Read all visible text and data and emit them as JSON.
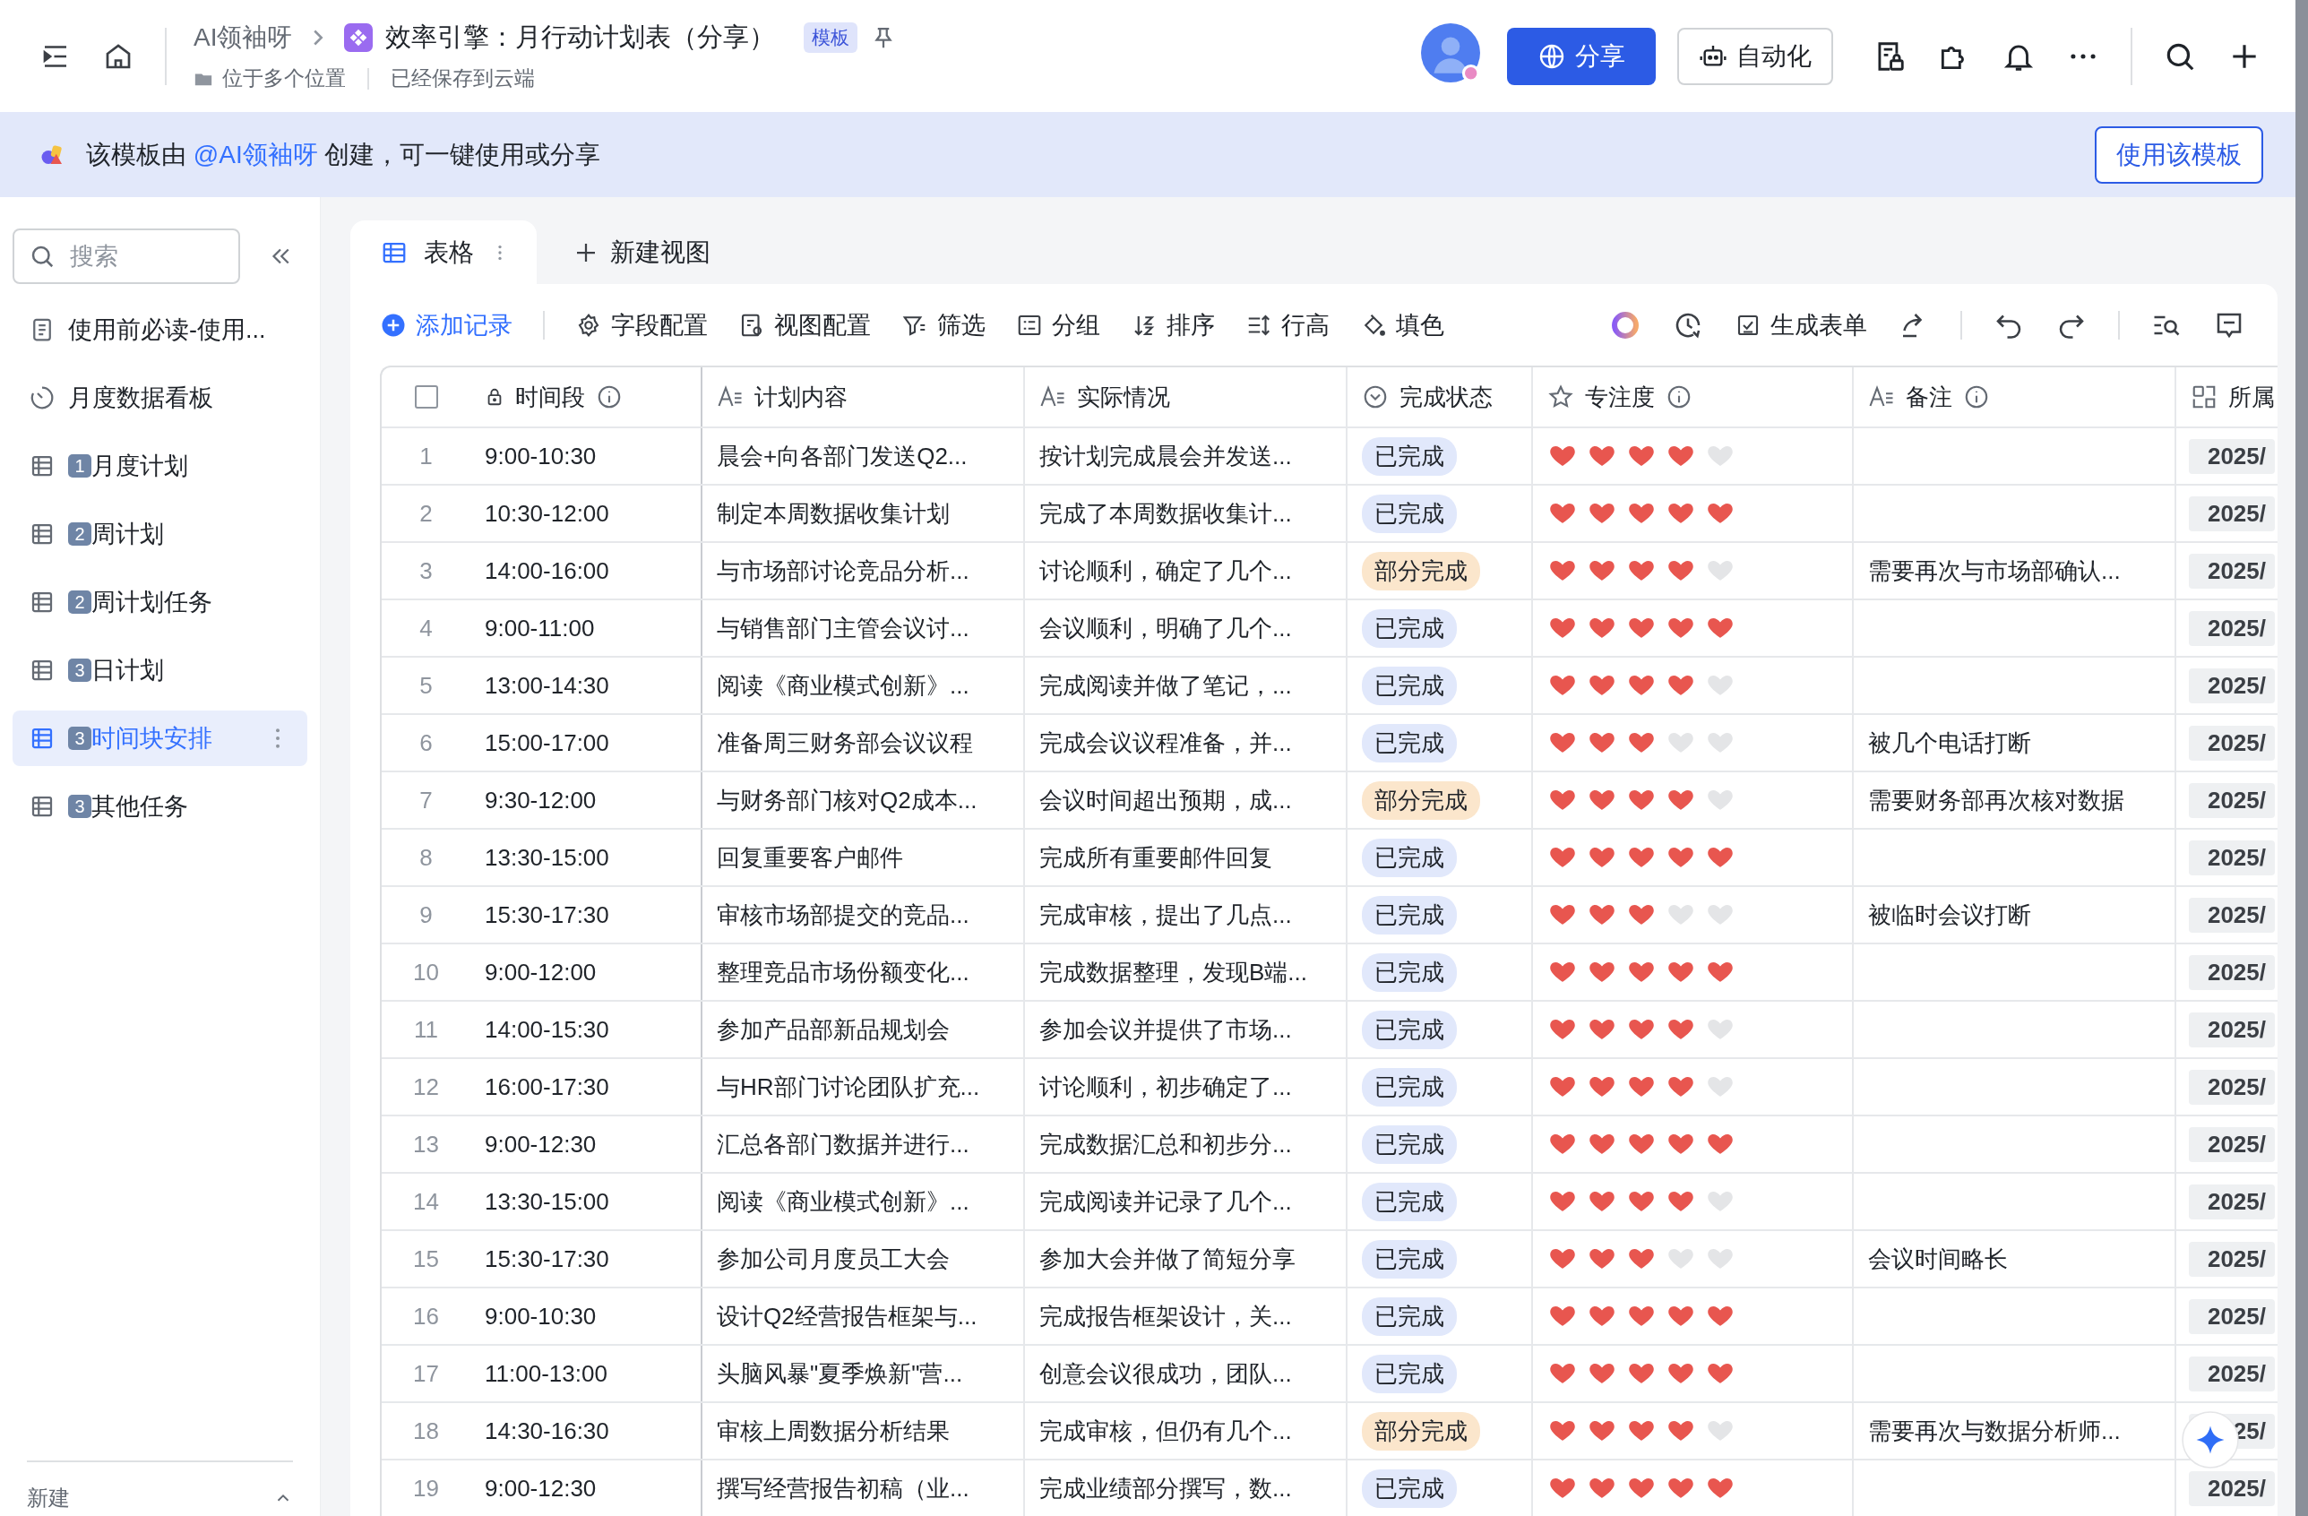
{
  "topbar": {
    "breadcrumb": "AI领袖呀",
    "title": "效率引擎：月行动计划表（分享）",
    "tag": "模板",
    "location": "位于多个位置",
    "save_status": "已经保存到云端",
    "share_button": "分享",
    "automation_button": "自动化"
  },
  "banner": {
    "before": "该模板由 ",
    "link": "@AI领袖呀",
    "after": " 创建，可一键使用或分享",
    "button": "使用该模板"
  },
  "sidebar": {
    "search": {
      "placeholder": "搜索"
    },
    "items": [
      {
        "kind": "doc",
        "label": "使用前必读-使用...",
        "selected": false
      },
      {
        "kind": "dashboard",
        "label": "月度数据看板",
        "selected": false
      },
      {
        "kind": "table",
        "badge": "1",
        "label": "月度计划",
        "selected": false
      },
      {
        "kind": "table",
        "badge": "2",
        "label": "周计划",
        "selected": false
      },
      {
        "kind": "table",
        "badge": "2",
        "label": "周计划任务",
        "selected": false
      },
      {
        "kind": "table",
        "badge": "3",
        "label": "日计划",
        "selected": false
      },
      {
        "kind": "table",
        "badge": "3",
        "label": "时间块安排",
        "selected": true
      },
      {
        "kind": "table",
        "badge": "3",
        "label": "其他任务",
        "selected": false
      }
    ],
    "footer": "新建"
  },
  "views": {
    "tabs": [
      {
        "label": "表格",
        "selected": true
      }
    ],
    "new_view": "新建视图"
  },
  "toolbar": {
    "add": "添加记录",
    "items": [
      "字段配置",
      "视图配置",
      "筛选",
      "分组",
      "排序",
      "行高",
      "填色"
    ],
    "form": "生成表单"
  },
  "table": {
    "select_all_checked": false,
    "columns": [
      {
        "kind": "time",
        "label": "时间段"
      },
      {
        "kind": "text",
        "label": "计划内容"
      },
      {
        "kind": "text",
        "label": "实际情况"
      },
      {
        "kind": "status",
        "label": "完成状态"
      },
      {
        "kind": "rating",
        "label": "专注度"
      },
      {
        "kind": "note",
        "label": "备注"
      },
      {
        "kind": "owner",
        "label": "所属"
      }
    ],
    "rows": [
      {
        "num": "1",
        "time": "9:00-10:30",
        "plan": "晨会+向各部门发送Q2...",
        "actual": "按计划完成晨会并发送...",
        "status": "已完成",
        "kind": "done",
        "stars": 4,
        "note": "",
        "owner": "2025/"
      },
      {
        "num": "2",
        "time": "10:30-12:00",
        "plan": "制定本周数据收集计划",
        "actual": "完成了本周数据收集计...",
        "status": "已完成",
        "kind": "done",
        "stars": 5,
        "note": "",
        "owner": "2025/"
      },
      {
        "num": "3",
        "time": "14:00-16:00",
        "plan": "与市场部讨论竞品分析...",
        "actual": "讨论顺利，确定了几个...",
        "status": "部分完成",
        "kind": "partial",
        "stars": 4,
        "note": "需要再次与市场部确认...",
        "owner": "2025/"
      },
      {
        "num": "4",
        "time": "9:00-11:00",
        "plan": "与销售部门主管会议讨...",
        "actual": "会议顺利，明确了几个...",
        "status": "已完成",
        "kind": "done",
        "stars": 5,
        "note": "",
        "owner": "2025/"
      },
      {
        "num": "5",
        "time": "13:00-14:30",
        "plan": "阅读《商业模式创新》...",
        "actual": "完成阅读并做了笔记，...",
        "status": "已完成",
        "kind": "done",
        "stars": 4,
        "note": "",
        "owner": "2025/"
      },
      {
        "num": "6",
        "time": "15:00-17:00",
        "plan": "准备周三财务部会议议程",
        "actual": "完成会议议程准备，并...",
        "status": "已完成",
        "kind": "done",
        "stars": 3,
        "note": "被几个电话打断",
        "owner": "2025/"
      },
      {
        "num": "7",
        "time": "9:30-12:00",
        "plan": "与财务部门核对Q2成本...",
        "actual": "会议时间超出预期，成...",
        "status": "部分完成",
        "kind": "partial",
        "stars": 4,
        "note": "需要财务部再次核对数据",
        "owner": "2025/"
      },
      {
        "num": "8",
        "time": "13:30-15:00",
        "plan": "回复重要客户邮件",
        "actual": "完成所有重要邮件回复",
        "status": "已完成",
        "kind": "done",
        "stars": 5,
        "note": "",
        "owner": "2025/"
      },
      {
        "num": "9",
        "time": "15:30-17:30",
        "plan": "审核市场部提交的竞品...",
        "actual": "完成审核，提出了几点...",
        "status": "已完成",
        "kind": "done",
        "stars": 3,
        "note": "被临时会议打断",
        "owner": "2025/"
      },
      {
        "num": "10",
        "time": "9:00-12:00",
        "plan": "整理竞品市场份额变化...",
        "actual": "完成数据整理，发现B端...",
        "status": "已完成",
        "kind": "done",
        "stars": 5,
        "note": "",
        "owner": "2025/"
      },
      {
        "num": "11",
        "time": "14:00-15:30",
        "plan": "参加产品部新品规划会",
        "actual": "参加会议并提供了市场...",
        "status": "已完成",
        "kind": "done",
        "stars": 4,
        "note": "",
        "owner": "2025/"
      },
      {
        "num": "12",
        "time": "16:00-17:30",
        "plan": "与HR部门讨论团队扩充...",
        "actual": "讨论顺利，初步确定了...",
        "status": "已完成",
        "kind": "done",
        "stars": 4,
        "note": "",
        "owner": "2025/"
      },
      {
        "num": "13",
        "time": "9:00-12:30",
        "plan": "汇总各部门数据并进行...",
        "actual": "完成数据汇总和初步分...",
        "status": "已完成",
        "kind": "done",
        "stars": 5,
        "note": "",
        "owner": "2025/"
      },
      {
        "num": "14",
        "time": "13:30-15:00",
        "plan": "阅读《商业模式创新》...",
        "actual": "完成阅读并记录了几个...",
        "status": "已完成",
        "kind": "done",
        "stars": 4,
        "note": "",
        "owner": "2025/"
      },
      {
        "num": "15",
        "time": "15:30-17:30",
        "plan": "参加公司月度员工大会",
        "actual": "参加大会并做了简短分享",
        "status": "已完成",
        "kind": "done",
        "stars": 3,
        "note": "会议时间略长",
        "owner": "2025/"
      },
      {
        "num": "16",
        "time": "9:00-10:30",
        "plan": "设计Q2经营报告框架与...",
        "actual": "完成报告框架设计，关...",
        "status": "已完成",
        "kind": "done",
        "stars": 5,
        "note": "",
        "owner": "2025/"
      },
      {
        "num": "17",
        "time": "11:00-13:00",
        "plan": "头脑风暴\"夏季焕新\"营...",
        "actual": "创意会议很成功，团队...",
        "status": "已完成",
        "kind": "done",
        "stars": 5,
        "note": "",
        "owner": "2025/"
      },
      {
        "num": "18",
        "time": "14:30-16:30",
        "plan": "审核上周数据分析结果",
        "actual": "完成审核，但仍有几个...",
        "status": "部分完成",
        "kind": "partial",
        "stars": 4,
        "note": "需要再次与数据分析师...",
        "owner": "25/"
      },
      {
        "num": "19",
        "time": "9:00-12:30",
        "plan": "撰写经营报告初稿（业...",
        "actual": "完成业绩部分撰写，数...",
        "status": "已完成",
        "kind": "done",
        "stars": 5,
        "note": "",
        "owner": "2025/"
      }
    ]
  }
}
